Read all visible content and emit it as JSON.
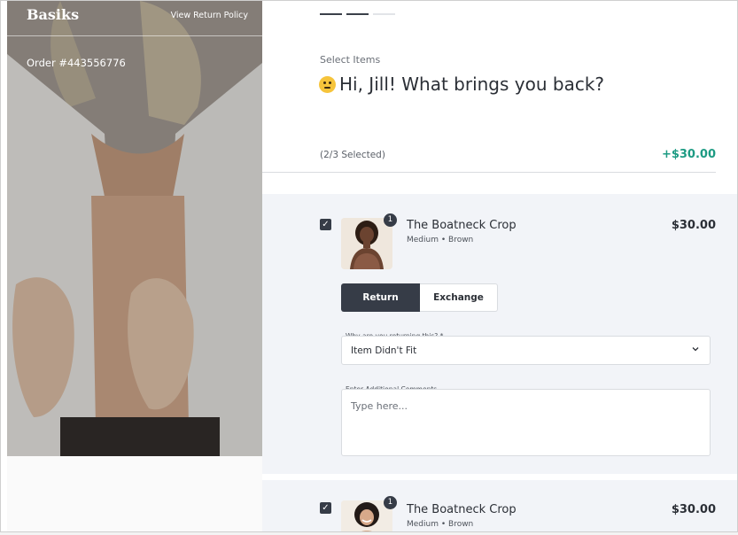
{
  "brand": {
    "name": "Basiks"
  },
  "header": {
    "policy_link": "View Return Policy"
  },
  "order": {
    "number_label": "Order #443556776"
  },
  "progress": {
    "steps_total": 3,
    "steps_done": 2
  },
  "step": {
    "label": "Select Items",
    "greeting": "Hi, Jill! What brings you back?",
    "emoji_icon": "thinking-face-icon"
  },
  "summary": {
    "selected_label": "(2/3 Selected)",
    "total": "+$30.00"
  },
  "items": [
    {
      "name": "The Boatneck Crop",
      "variant": "Medium • Brown",
      "price": "$30.00",
      "quantity": "1",
      "checked": true,
      "actions": {
        "return_label": "Return",
        "exchange_label": "Exchange",
        "selected": "Return"
      },
      "reason": {
        "label": "Why are you returning this? *",
        "value": "Item Didn't Fit"
      },
      "comments": {
        "label": "Enter Additional Comments",
        "placeholder": "Type here..."
      }
    },
    {
      "name": "The Boatneck Crop",
      "variant": "Medium • Brown",
      "price": "$30.00",
      "quantity": "1",
      "checked": true
    }
  ],
  "colors": {
    "accent": "#363c47",
    "positive": "#1d9b83",
    "card_bg": "#f2f4f8"
  }
}
